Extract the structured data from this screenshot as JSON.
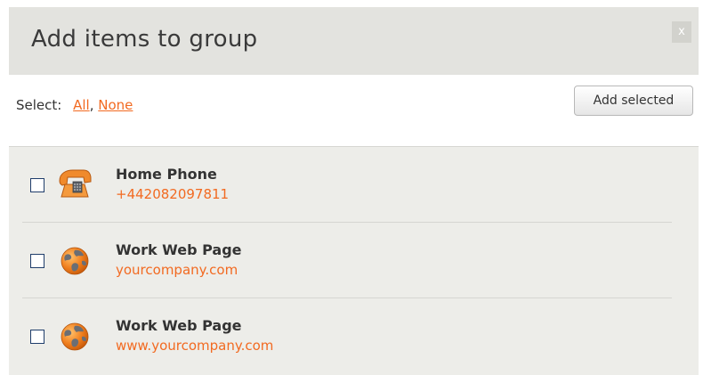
{
  "dialog": {
    "title": "Add items to group",
    "close_label": "x"
  },
  "toolbar": {
    "select_label": "Select:",
    "all_label": "All",
    "separator": ",",
    "none_label": "None",
    "add_selected_label": "Add selected"
  },
  "items": [
    {
      "title": "Home Phone",
      "value": "+442082097811",
      "icon": "phone-icon",
      "checked": false
    },
    {
      "title": "Work Web Page",
      "value": "yourcompany.com",
      "icon": "globe-icon",
      "checked": false
    },
    {
      "title": "Work Web Page",
      "value": "www.yourcompany.com",
      "icon": "globe-icon",
      "checked": false
    }
  ],
  "colors": {
    "accent": "#f26a21",
    "header_bg": "#e3e3df",
    "list_bg": "#edede9"
  }
}
